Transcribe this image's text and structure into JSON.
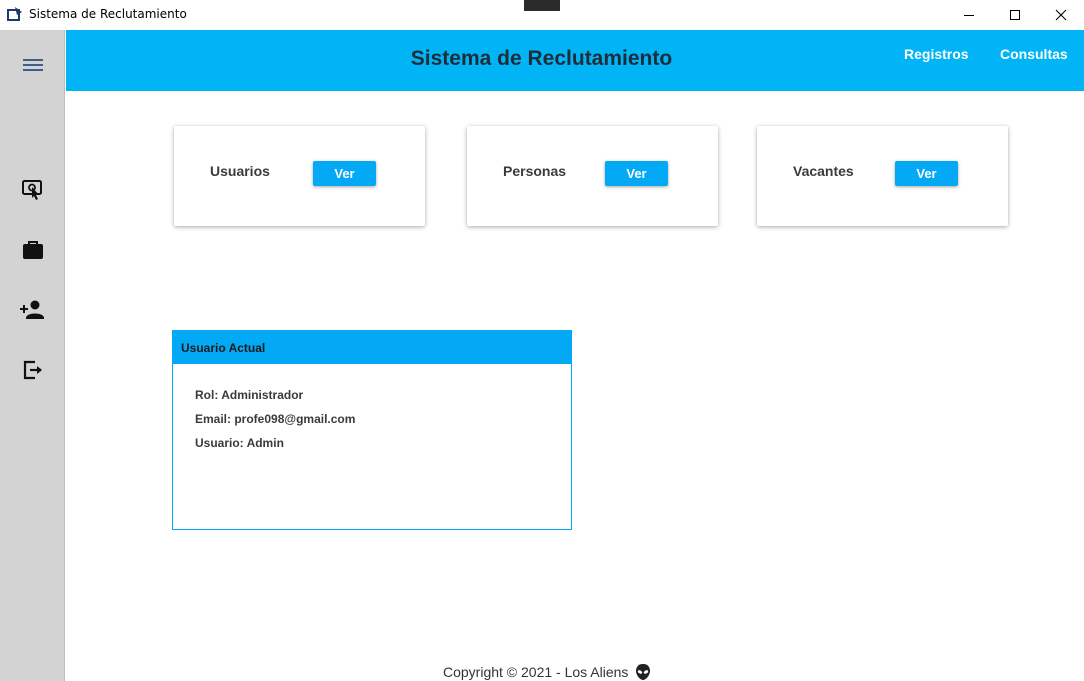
{
  "window": {
    "title": "Sistema de Reclutamiento",
    "controls": [
      "minimize",
      "maximize",
      "close"
    ]
  },
  "header": {
    "title": "Sistema de Reclutamiento",
    "nav": [
      "Registros",
      "Consultas"
    ]
  },
  "sidebar": {
    "items": [
      {
        "icon": "menu-icon"
      },
      {
        "icon": "touch-screen-icon"
      },
      {
        "icon": "briefcase-icon"
      },
      {
        "icon": "add-person-icon"
      },
      {
        "icon": "logout-icon"
      }
    ]
  },
  "cards": [
    {
      "label": "Usuarios",
      "button": "Ver"
    },
    {
      "label": "Personas",
      "button": "Ver"
    },
    {
      "label": "Vacantes",
      "button": "Ver"
    }
  ],
  "user_panel": {
    "title": "Usuario Actual",
    "rol": "Rol: Administrador",
    "email": "Email: profe098@gmail.com",
    "usuario": "Usuario: Admin"
  },
  "footer": {
    "text": "Copyright © 2021 - Los Aliens",
    "icon": "alien-icon"
  },
  "colors": {
    "header": "#00b4f6",
    "accent": "#03a9f4",
    "sidebar": "#d3d3d3"
  }
}
